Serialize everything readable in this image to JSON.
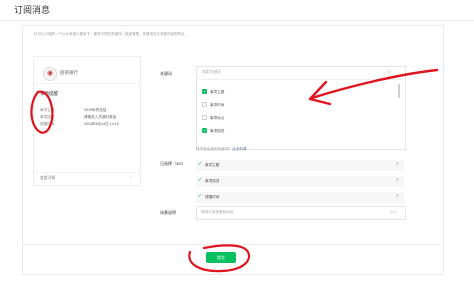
{
  "page": {
    "title": "订阅消息"
  },
  "intro": "在可以订阅的一个公众号或小程序下，使用不同的关键词，描述清楚，关键词应与消息内容相符合。",
  "card": {
    "account_name": "招商银行",
    "message_title": "事项提醒",
    "fields": [
      {
        "label": "事项主题",
        "value": "2019年终总结"
      },
      {
        "label": "事项描述",
        "value": "请相关人员准时参加"
      },
      {
        "label": "提醒时间",
        "value": "2024年6月14日 14:15"
      }
    ],
    "details_label": "查看详情",
    "arrow": "›"
  },
  "keywords": {
    "label": "关键词",
    "search_placeholder": "搜索关键词",
    "items": [
      {
        "label": "事项主题",
        "checked": true
      },
      {
        "label": "事项时间",
        "checked": false
      },
      {
        "label": "事项地点",
        "checked": false
      },
      {
        "label": "事项描述",
        "checked": true
      }
    ],
    "hint": "找不到合适的关键词？",
    "hint_link": "点击申请"
  },
  "selected": {
    "label": "已选择（3/5）",
    "items": [
      "事项主题",
      "事项描述",
      "提醒时间"
    ]
  },
  "scene": {
    "label": "场景说明",
    "placeholder": "简明订阅场景和用途",
    "counter": "0/ 1"
  },
  "submit": {
    "label": "提交"
  },
  "annotation_color": "#e0141e",
  "icons": {
    "search": "search-icon",
    "check": "check-icon",
    "drag": "drag-handle-icon"
  }
}
